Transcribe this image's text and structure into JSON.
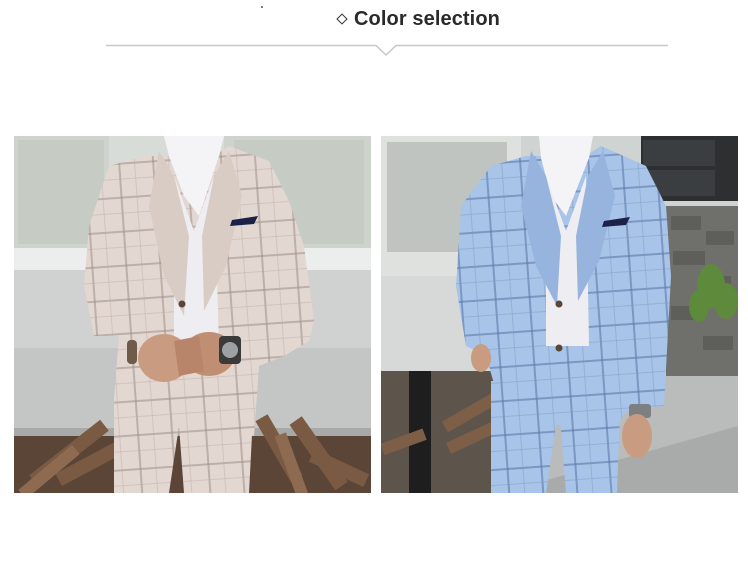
{
  "header": {
    "title": "Color selection",
    "icon": "diamond-outline-icon"
  },
  "products": [
    {
      "color_name": "beige-plaid-suit",
      "swatch": "#e6d9d3"
    },
    {
      "color_name": "blue-plaid-suit",
      "swatch": "#a9c6ea"
    }
  ],
  "colors": {
    "title_text": "#2a2a2a",
    "divider": "#c8c8c8"
  }
}
